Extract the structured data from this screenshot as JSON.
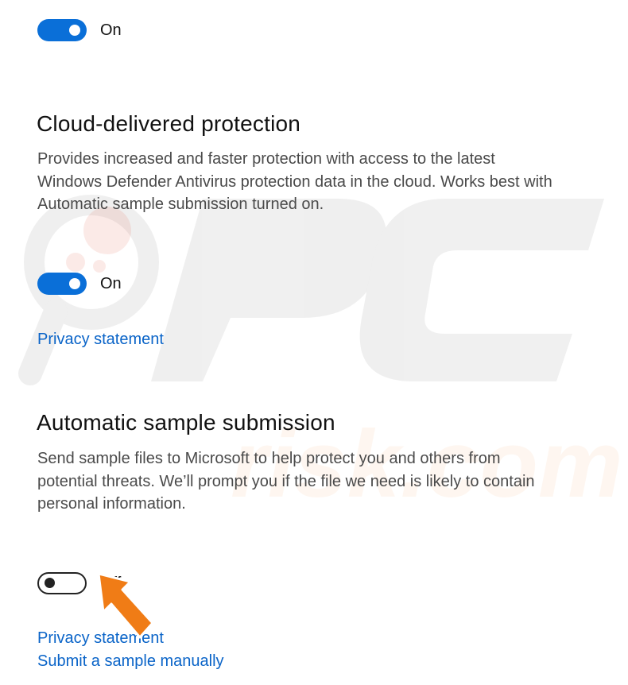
{
  "top_toggle": {
    "state_label": "On",
    "is_on": true
  },
  "cloud": {
    "title": "Cloud-delivered protection",
    "description_lines": [
      "Provides increased and faster protection with access to the latest",
      "Windows Defender Antivirus protection data in the cloud. Works best with",
      "Automatic sample submission turned on."
    ],
    "toggle": {
      "state_label": "On",
      "is_on": true
    },
    "privacy_link": "Privacy statement"
  },
  "sample": {
    "title": "Automatic sample submission",
    "description_lines": [
      "Send sample files to Microsoft to help protect you and others from",
      "potential threats.  We’ll prompt you if the file we need is likely to contain",
      "personal information."
    ],
    "toggle": {
      "state_label": "Off",
      "is_on": false
    },
    "privacy_link": "Privacy statement",
    "submit_link": "Submit a sample manually"
  },
  "watermark": {
    "text": "PC risk.com"
  },
  "colors": {
    "accent": "#0a6fd8",
    "link": "#0a64c8",
    "annotation_arrow": "#f07c16"
  }
}
